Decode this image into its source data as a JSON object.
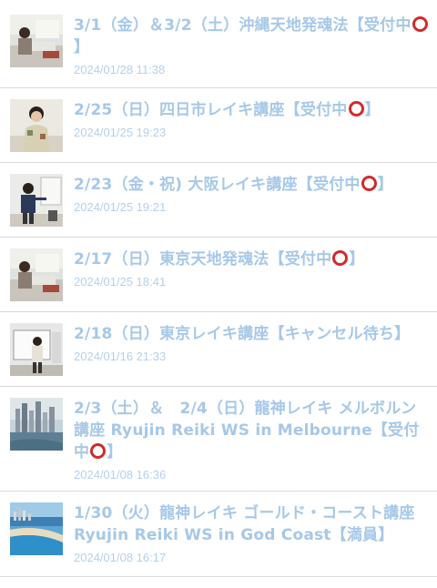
{
  "posts": [
    {
      "title_before": "3/1（金）＆3/2（土）沖縄天地発魂法【受付中",
      "title_after": "】",
      "date": "2024/01/28 11:38",
      "thumb_icon": "seminar-photo-icon"
    },
    {
      "title_before": "2/25（日）四日市レイキ講座【受付中",
      "title_after": "】",
      "date": "2024/01/25 19:23",
      "thumb_icon": "person-photo-icon"
    },
    {
      "title_before": "2/23（金・祝) 大阪レイキ講座【受付中",
      "title_after": "】",
      "date": "2024/01/25 19:21",
      "thumb_icon": "presenter-photo-icon"
    },
    {
      "title_before": "2/17（日）東京天地発魂法【受付中",
      "title_after": "】",
      "date": "2024/01/25 18:41",
      "thumb_icon": "seminar-photo-icon"
    },
    {
      "title_before": "2/18（日）東京レイキ講座【キャンセル待ち】",
      "title_after": "",
      "date": "2024/01/16 21:33",
      "thumb_icon": "whiteboard-photo-icon"
    },
    {
      "title_before": "2/3（土）＆　2/4（日）龍神レイキ メルボルン講座 Ryujin Reiki WS in Melbourne【受付中",
      "title_after": "】",
      "date": "2024/01/08 16:36",
      "thumb_icon": "city-photo-icon"
    },
    {
      "title_before": "1/30（火）龍神レイキ ゴールド・コースト講座　Ryujin Reiki WS in God Coast【満員】",
      "title_after": "",
      "date": "2024/01/08 16:17",
      "thumb_icon": "beach-photo-icon"
    }
  ],
  "colors": {
    "title": "#a6c8e8",
    "date": "#b5d0ea",
    "mark": "#d12a2a",
    "divider": "#d9d9d9"
  }
}
